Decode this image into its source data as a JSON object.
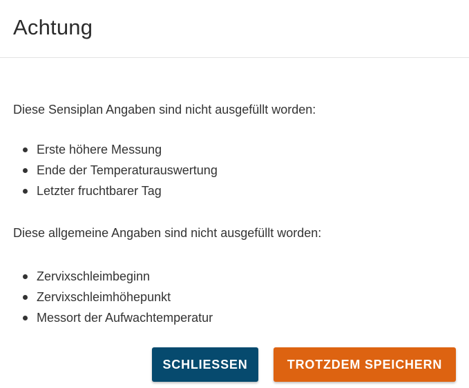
{
  "dialog": {
    "title": "Achtung",
    "section1": {
      "intro": "Diese Sensiplan Angaben sind nicht ausgefüllt worden:",
      "items": [
        "Erste höhere Messung",
        "Ende der Temperaturauswertung",
        "Letzter fruchtbarer Tag"
      ]
    },
    "section2": {
      "intro": "Diese allgemeine Angaben sind nicht ausgefüllt worden:",
      "items": [
        "Zervixschleimbeginn",
        "Zervixschleimhöhepunkt",
        "Messort der Aufwachtemperatur"
      ]
    },
    "actions": {
      "close_label": "SCHLIESSEN",
      "save_label": "TROTZDEM SPEICHERN"
    }
  },
  "colors": {
    "close_button": "#064a6e",
    "save_button": "#dd6311"
  }
}
